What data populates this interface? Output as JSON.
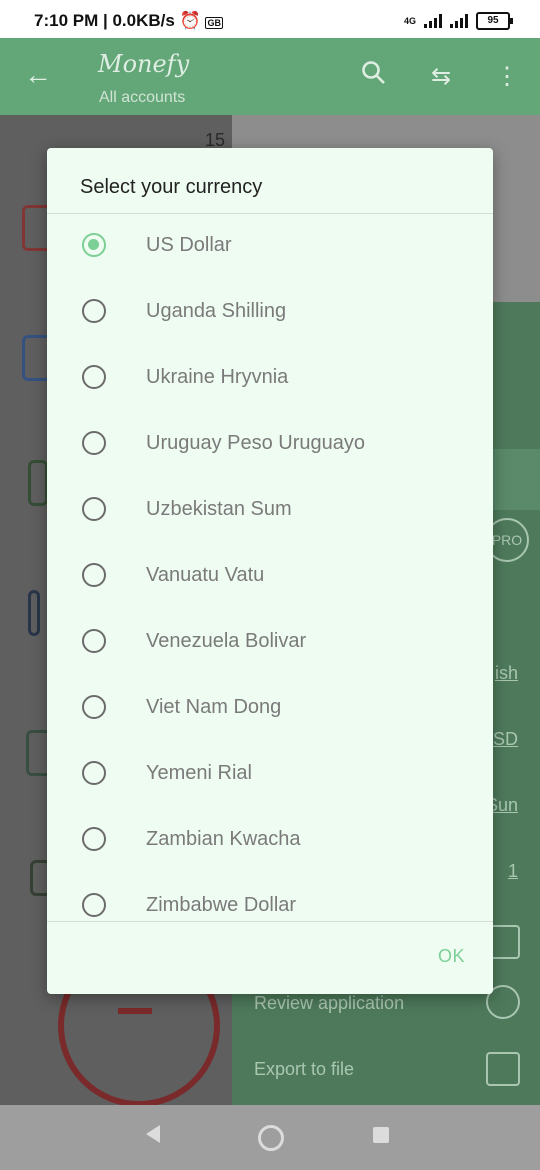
{
  "status": {
    "time": "7:10 PM",
    "speed": "0.0KB/s",
    "alarm_icon": "alarm-icon",
    "gb_icon": "GB",
    "network": "4G",
    "battery": "95"
  },
  "appbar": {
    "title": "Monefy",
    "subtitle": "All accounts",
    "icons": [
      "back-arrow-icon",
      "search-icon",
      "transfer-icon",
      "more-vert-icon"
    ]
  },
  "background": {
    "date_fragment": "15",
    "right_panel": {
      "language_fragment": "ish",
      "currency_fragment": "SD",
      "day_fragment": "Sun",
      "number_fragment": "1",
      "pro_badge": "PRO",
      "review": "Review application",
      "export": "Export to file"
    }
  },
  "dialog": {
    "title": "Select your currency",
    "ok": "OK",
    "selected": "US Dollar",
    "items": [
      "US Dollar",
      "Uganda Shilling",
      "Ukraine Hryvnia",
      "Uruguay Peso Uruguayo",
      "Uzbekistan Sum",
      "Vanuatu Vatu",
      "Venezuela Bolivar",
      "Viet Nam Dong",
      "Yemeni Rial",
      "Zambian Kwacha",
      "Zimbabwe Dollar"
    ]
  },
  "colors": {
    "accent": "#7ccf95",
    "appbar_dim": "#63a677",
    "dialog_bg": "#effcf2"
  }
}
